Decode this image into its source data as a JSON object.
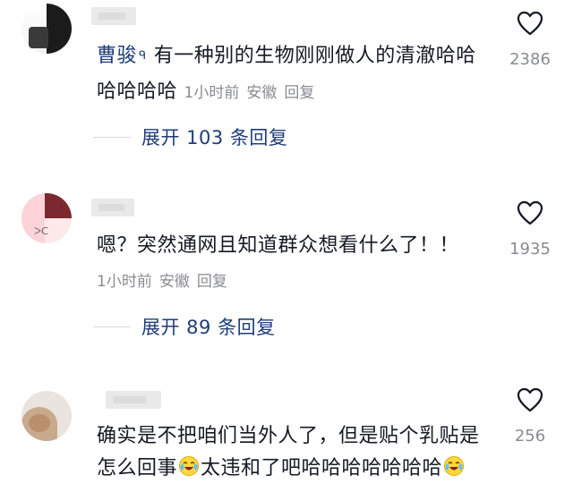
{
  "comments": [
    {
      "author": "曹骏",
      "author_badge": "ᑫ",
      "text_line1": "有一种别的生物刚刚做人的清澈哈哈",
      "text_line2": "哈哈哈哈",
      "time": "1小时前",
      "location": "安徽",
      "reply": "回复",
      "likes": "2386",
      "expand": "展开 103 条回复"
    },
    {
      "author": "",
      "text_line1": "嗯？突然通网且知道群众想看什么了！！",
      "time": "1小时前",
      "location": "安徽",
      "reply": "回复",
      "likes": "1935",
      "expand": "展开 89 条回复"
    },
    {
      "author": "",
      "text_line1": "确实是不把咱们当外人了，但是贴个乳贴是",
      "text_line2a": "怎么回事",
      "text_line2b": "太违和了吧哈哈哈哈哈哈哈",
      "likes": "256",
      "emoji": "crying-laughing-emoji"
    }
  ],
  "colors": {
    "link": "#1f3d7a",
    "meta": "#8a8b91",
    "text": "#161823"
  }
}
